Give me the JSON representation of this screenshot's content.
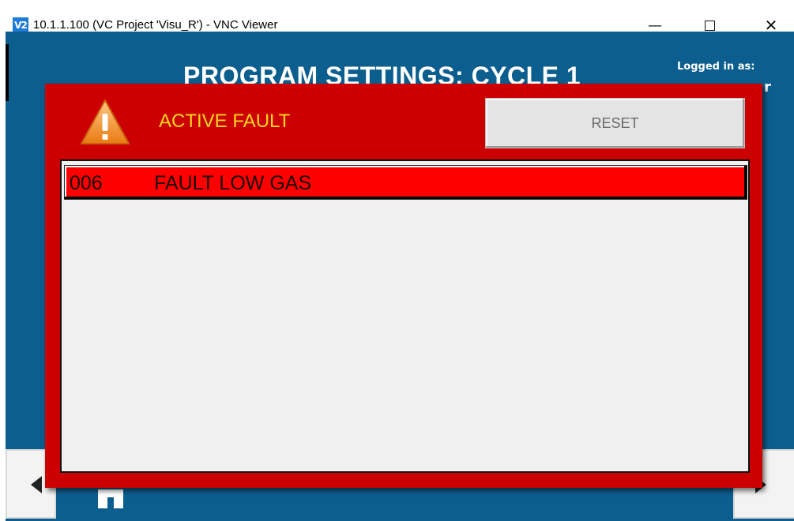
{
  "window": {
    "app_icon_text": "V2",
    "title": "10.1.1.100 (VC Project 'Visu_R') - VNC Viewer",
    "minimize_glyph": "—",
    "close_glyph": "✕"
  },
  "hmi": {
    "page_title": "PROGRAM SETTINGS: CYCLE 1",
    "logged_in_label": "Logged in as:",
    "user_name_fragment": "r",
    "background_color": "#0c5e8e",
    "nav_icons": [
      "arrow-left-icon",
      "arrow-right-icon",
      "home-icon"
    ]
  },
  "fault_dialog": {
    "heading": "ACTIVE FAULT",
    "reset_label": "RESET",
    "icon": "warning-triangle-icon",
    "background_color": "#cc0000",
    "heading_color": "#ffd61c",
    "faults": [
      {
        "code": "006",
        "text": "FAULT LOW GAS",
        "highlight_color": "#ff0000"
      }
    ]
  }
}
